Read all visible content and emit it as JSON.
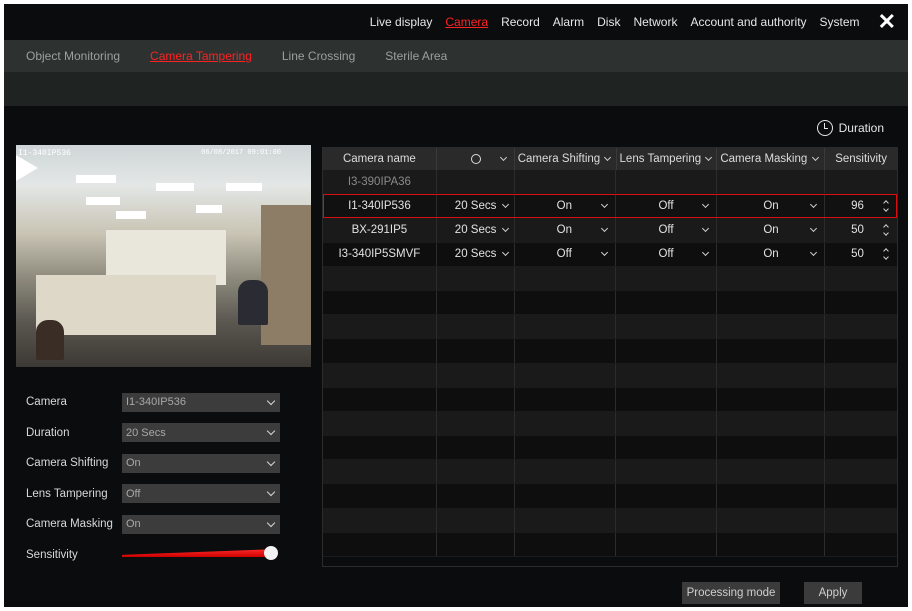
{
  "top_nav": {
    "items": [
      "Live display",
      "Camera",
      "Record",
      "Alarm",
      "Disk",
      "Network",
      "Account and authority",
      "System"
    ],
    "active": "Camera",
    "close": "✕"
  },
  "sub_nav": {
    "items": [
      "Object Monitoring",
      "Camera Tampering",
      "Line Crossing",
      "Sterile Area"
    ],
    "active": "Camera Tampering"
  },
  "duration_button": "Duration",
  "preview": {
    "camera_label": "I1-340IP536",
    "timestamp": "06/08/2017 09:01:00"
  },
  "settings": {
    "camera": {
      "label": "Camera",
      "value": "I1-340IP536"
    },
    "duration": {
      "label": "Duration",
      "value": "20 Secs"
    },
    "camera_shifting": {
      "label": "Camera Shifting",
      "value": "On"
    },
    "lens_tampering": {
      "label": "Lens Tampering",
      "value": "Off"
    },
    "camera_masking": {
      "label": "Camera Masking",
      "value": "On"
    },
    "sensitivity": {
      "label": "Sensitivity",
      "level_percent": 96
    }
  },
  "table": {
    "headers": {
      "camera_name": "Camera name",
      "camera_shifting": "Camera Shifting",
      "lens_tampering": "Lens Tampering",
      "camera_masking": "Camera Masking",
      "sensitivity": "Sensitivity"
    },
    "rows": [
      {
        "name": "I3-390IPA36",
        "disabled": true
      },
      {
        "name": "I1-340IP536",
        "duration": "20 Secs",
        "shifting": "On",
        "lens": "Off",
        "masking": "On",
        "sensitivity": "96",
        "selected": true
      },
      {
        "name": "BX-291IP5",
        "duration": "20 Secs",
        "shifting": "On",
        "lens": "Off",
        "masking": "On",
        "sensitivity": "50"
      },
      {
        "name": "I3-340IP5SMVF",
        "duration": "20 Secs",
        "shifting": "Off",
        "lens": "Off",
        "masking": "On",
        "sensitivity": "50"
      }
    ]
  },
  "buttons": {
    "processing_mode": "Processing mode",
    "apply": "Apply"
  }
}
